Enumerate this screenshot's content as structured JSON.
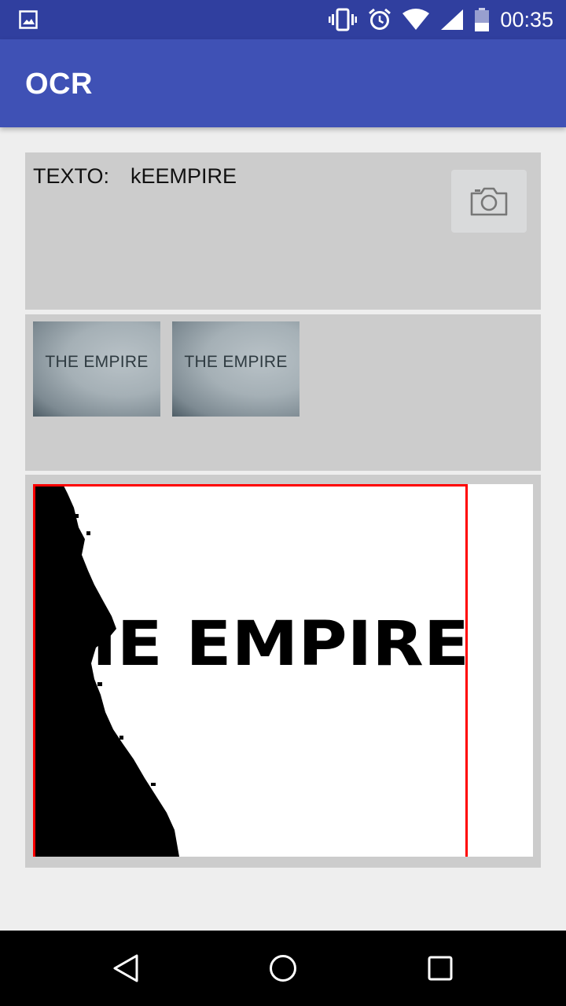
{
  "status_bar": {
    "time": "00:35",
    "icons": [
      "gallery-icon",
      "vibrate-icon",
      "alarm-icon",
      "wifi-icon",
      "signal-icon",
      "battery-icon"
    ]
  },
  "app_bar": {
    "title": "OCR"
  },
  "result": {
    "label": "TEXTO:",
    "value": "kEEMPIRE"
  },
  "camera_button": {
    "icon": "camera-icon"
  },
  "thumbnails": [
    {
      "text": "THE EMPIRE"
    },
    {
      "text": "THE EMPIRE"
    }
  ],
  "processed_image": {
    "text": "IE EMPIRE",
    "box_color": "#ff0000"
  },
  "nav_bar": {
    "icons": [
      "back-icon",
      "home-icon",
      "recents-icon"
    ]
  },
  "colors": {
    "primary": "#3f51b5",
    "primary_dark": "#303f9f",
    "panel": "#cccccc",
    "background": "#eeeeee"
  }
}
